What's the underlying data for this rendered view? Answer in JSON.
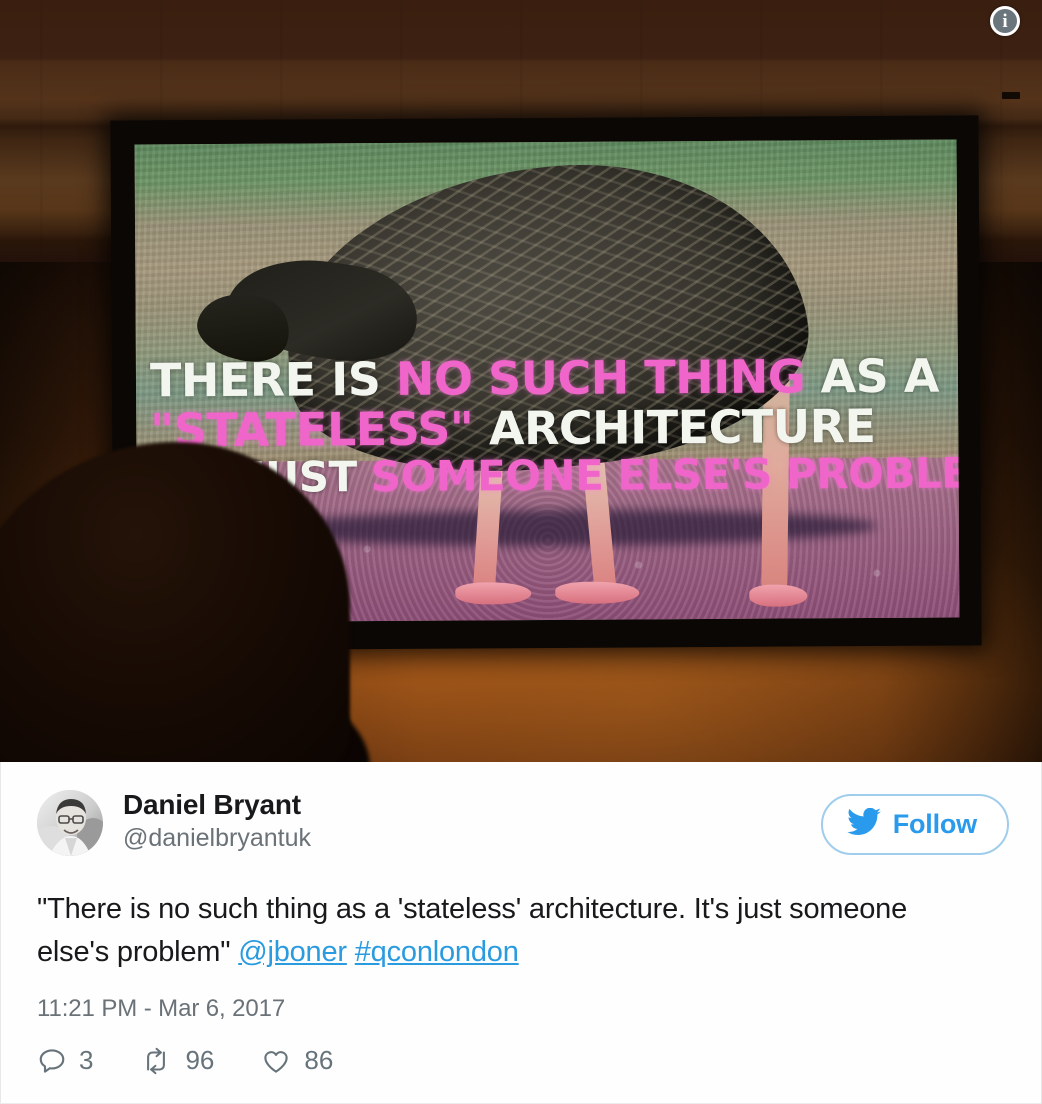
{
  "photo": {
    "alt_description": "conference-projector-screen-photo",
    "info_badge": "i",
    "slide": {
      "line1_white_a": "THERE IS ",
      "line1_pink": "NO SUCH THING",
      "line1_white_b": " AS A",
      "line2_pink": "\"STATELESS\"",
      "line2_white": " ARCHITECTURE",
      "line3_white": "IT'S JUST ",
      "line3_pink": "SOMEONE ELSE'S PROBLEM"
    },
    "colors": {
      "slide_white": "#f2f6ee",
      "slide_pink": "#f065c9",
      "wall_brown": "#52290e",
      "screen_frame": "#0a0705"
    }
  },
  "tweet": {
    "display_name": "Daniel Bryant",
    "handle": "@danielbryantuk",
    "follow_label": "Follow",
    "body": {
      "text_part1": "\"There is no such thing as a 'stateless' architecture. It's just someone else's problem\" ",
      "mention": "@jboner",
      "space": " ",
      "hashtag": "#qconlondon"
    },
    "timestamp": "11:21 PM - Mar 6, 2017",
    "actions": {
      "reply_count": "3",
      "retweet_count": "96",
      "like_count": "86"
    },
    "colors": {
      "link_blue": "#2b9be0",
      "follow_blue": "#2a9bec",
      "follow_border": "#9fcdeb",
      "meta_gray": "#6a7278",
      "text_black": "#18191a"
    }
  }
}
